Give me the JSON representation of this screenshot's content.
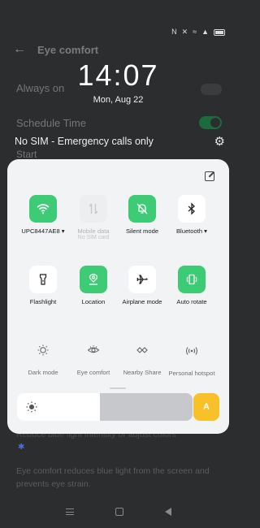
{
  "status_bar": {
    "icons": [
      "nfc-icon",
      "mute-icon",
      "wifi-icon",
      "signal-icon",
      "battery-icon"
    ]
  },
  "background": {
    "title": "Eye comfort",
    "always_on": "Always on",
    "schedule_time": "Schedule Time",
    "start": "Start",
    "desc_top": "Reduce blue light intensity or adjust colors",
    "description": "Eye comfort reduces blue light from the screen and prevents eye strain."
  },
  "lockscreen": {
    "time": "14:07",
    "date": "Mon, Aug 22",
    "sim_status": "No SIM - Emergency calls only"
  },
  "tiles": [
    {
      "label": "UPC8447AE8 ▾",
      "sub": "",
      "state": "on",
      "icon": "wifi-icon"
    },
    {
      "label": "Mobile data",
      "sub": "No SIM card",
      "state": "disabled",
      "icon": "mobile-data-icon"
    },
    {
      "label": "Silent mode",
      "sub": "",
      "state": "on",
      "icon": "bell-off-icon"
    },
    {
      "label": "Bluetooth ▾",
      "sub": "",
      "state": "off",
      "icon": "bluetooth-icon"
    },
    {
      "label": "Flashlight",
      "sub": "",
      "state": "off",
      "icon": "flashlight-icon"
    },
    {
      "label": "Location",
      "sub": "",
      "state": "on",
      "icon": "location-icon"
    },
    {
      "label": "Airplane mode",
      "sub": "",
      "state": "off",
      "icon": "airplane-icon"
    },
    {
      "label": "Auto rotate",
      "sub": "",
      "state": "on",
      "icon": "rotate-icon"
    },
    {
      "label": "Dark mode",
      "sub": "",
      "state": "off",
      "icon": "dark-mode-icon"
    },
    {
      "label": "Eye comfort",
      "sub": "",
      "state": "off",
      "icon": "eye-icon"
    },
    {
      "label": "Nearby Share",
      "sub": "",
      "state": "off",
      "icon": "nearby-share-icon"
    },
    {
      "label": "Personal hotspot",
      "sub": "",
      "state": "off",
      "icon": "hotspot-icon"
    }
  ],
  "brightness": {
    "level": 0.47,
    "auto_label": "A"
  },
  "colors": {
    "accent_green": "#3ecb76",
    "auto_yellow": "#f8c12a",
    "panel_bg": "#f2f3f5"
  }
}
